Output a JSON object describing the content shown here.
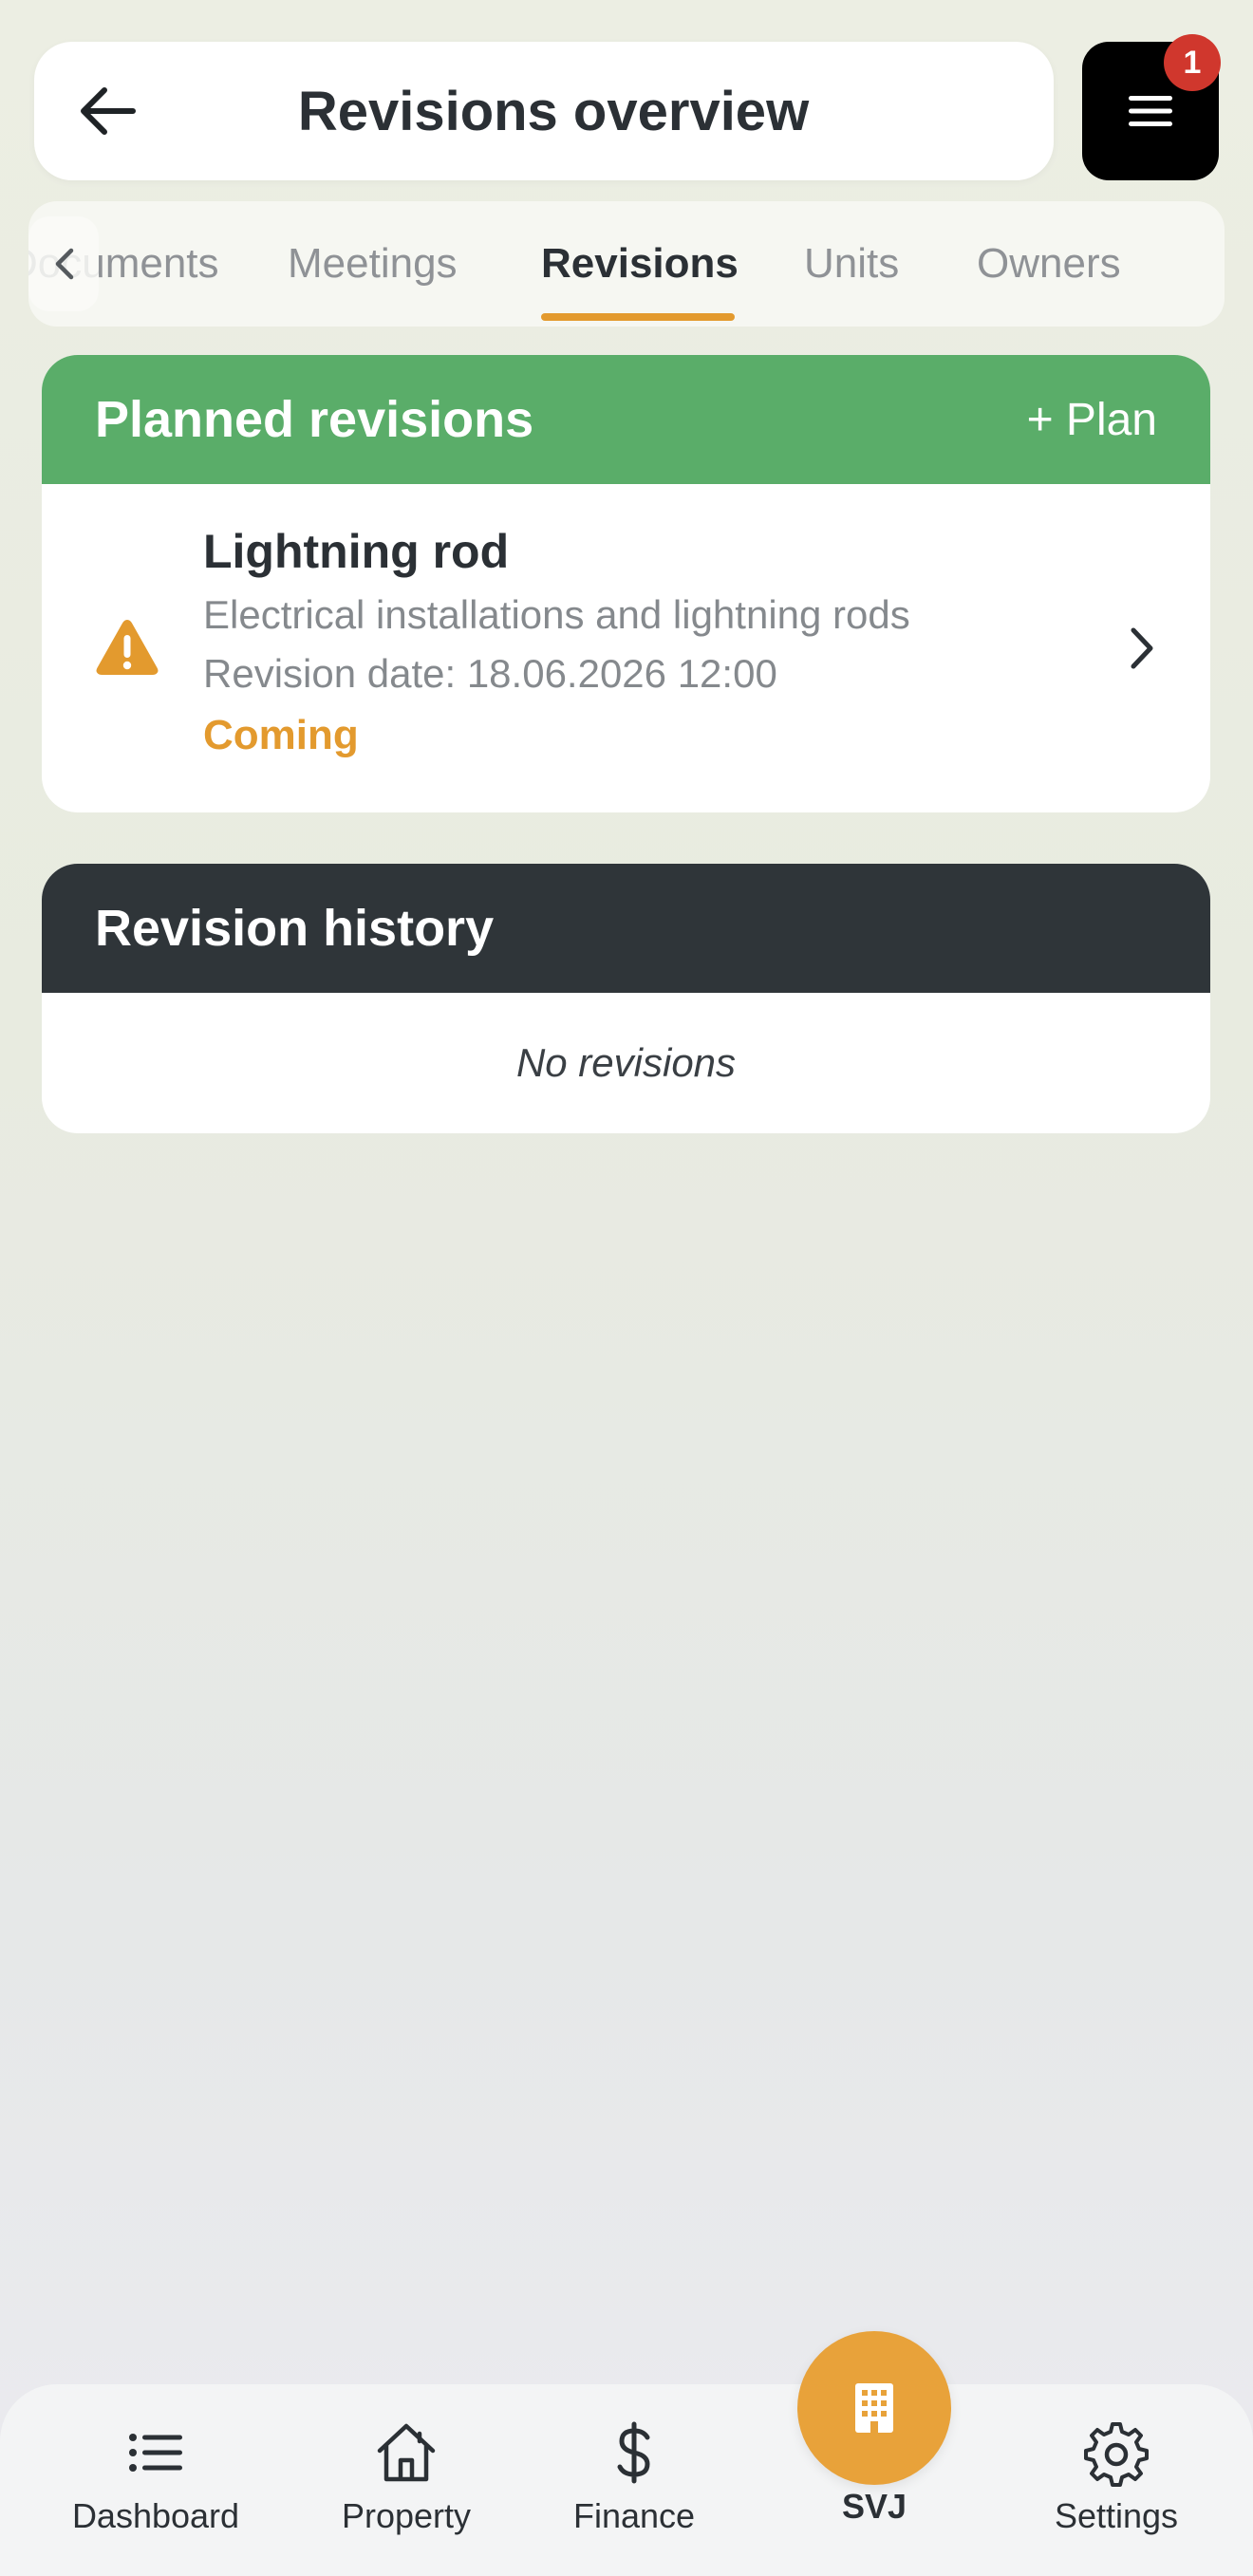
{
  "header": {
    "title": "Revisions overview",
    "notification_count": "1"
  },
  "tabs": [
    {
      "label": "Documents"
    },
    {
      "label": "Meetings"
    },
    {
      "label": "Revisions",
      "active": true
    },
    {
      "label": "Units"
    },
    {
      "label": "Owners"
    }
  ],
  "planned": {
    "title": "Planned revisions",
    "plan_button": "+ Plan",
    "items": [
      {
        "title": "Lightning rod",
        "category": "Electrical installations and lightning rods",
        "date": "Revision date: 18.06.2026 12:00",
        "status": "Coming",
        "icon": "warning-icon"
      }
    ]
  },
  "history": {
    "title": "Revision history",
    "empty_text": "No revisions"
  },
  "nav": {
    "items": [
      {
        "label": "Dashboard",
        "icon": "list-icon"
      },
      {
        "label": "Property",
        "icon": "home-icon"
      },
      {
        "label": "Finance",
        "icon": "dollar-icon"
      },
      {
        "label": "SVJ",
        "icon": "building-icon"
      },
      {
        "label": "Settings",
        "icon": "gear-icon"
      }
    ]
  },
  "colors": {
    "accent": "#e39a2e",
    "planned_header": "#5aad69",
    "history_header": "#2f3539",
    "badge": "#d0372d"
  }
}
